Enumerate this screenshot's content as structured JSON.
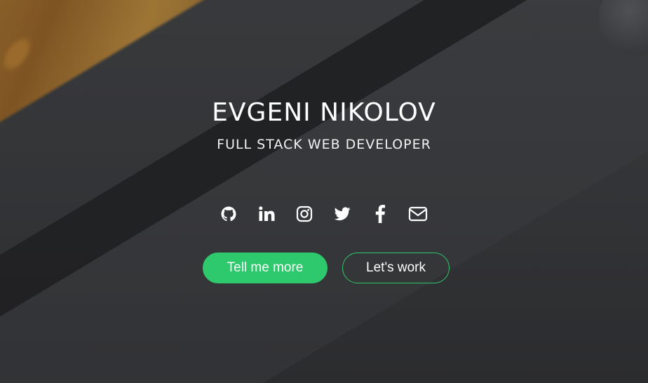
{
  "hero": {
    "name": "EVGENI NIKOLOV",
    "role": "FULL STACK WEB DEVELOPER"
  },
  "socials": [
    {
      "icon": "github-icon"
    },
    {
      "icon": "linkedin-icon"
    },
    {
      "icon": "instagram-icon"
    },
    {
      "icon": "twitter-icon"
    },
    {
      "icon": "facebook-icon"
    },
    {
      "icon": "email-icon"
    }
  ],
  "buttons": {
    "primary_label": "Tell me more",
    "secondary_label": "Let's work"
  },
  "colors": {
    "accent": "#2ec96c",
    "text": "#ffffff",
    "background": "#3a3c3e"
  }
}
